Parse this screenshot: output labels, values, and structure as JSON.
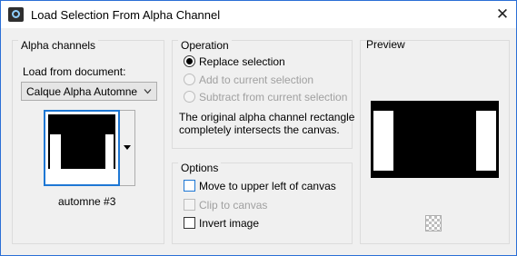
{
  "window": {
    "title": "Load Selection From Alpha Channel",
    "close_glyph": "✕"
  },
  "alpha_channels": {
    "legend": "Alpha channels",
    "load_from_label": "Load from document:",
    "document_selected": "Calque Alpha Automne",
    "channel_name": "automne #3"
  },
  "operation": {
    "legend": "Operation",
    "options": [
      {
        "label": "Replace selection",
        "checked": true,
        "enabled": true
      },
      {
        "label": "Add to current selection",
        "checked": false,
        "enabled": false
      },
      {
        "label": "Subtract from current selection",
        "checked": false,
        "enabled": false
      }
    ],
    "message_line1": "The original alpha channel rectangle",
    "message_line2": "completely intersects the canvas."
  },
  "options": {
    "legend": "Options",
    "items": [
      {
        "label": "Move to upper left of canvas",
        "checked": false,
        "enabled": true
      },
      {
        "label": "Clip to canvas",
        "checked": false,
        "enabled": false
      },
      {
        "label": "Invert image",
        "checked": false,
        "enabled": true
      }
    ]
  },
  "preview": {
    "legend": "Preview",
    "background_button_icon": "checkerboard-icon"
  },
  "colors": {
    "focus": "#1e77d4",
    "disabled_text": "#a0a0a0",
    "dialog_bg": "#f0f0f0"
  }
}
